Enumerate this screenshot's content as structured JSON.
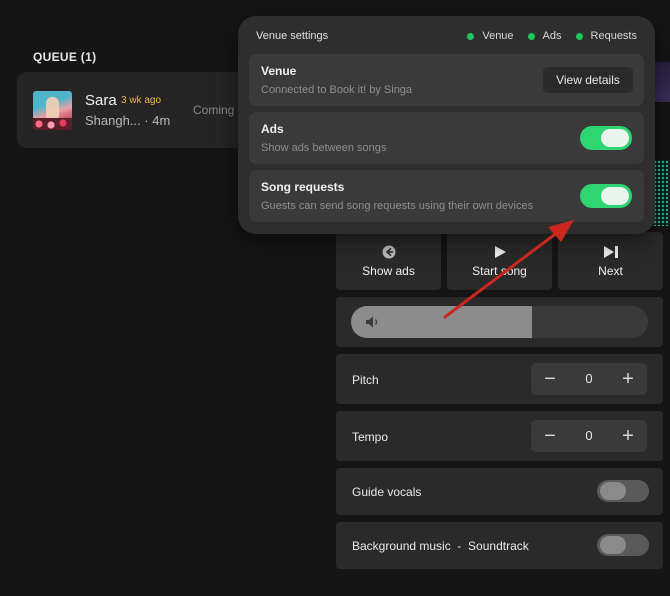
{
  "queue": {
    "title": "QUEUE (1)",
    "item": {
      "name": "Sara",
      "time_ago": "3 wk ago",
      "song": "Shangh... · 4m",
      "status": "Coming"
    }
  },
  "controls": {
    "show_ads_label": "Show ads",
    "start_song_label": "Start song",
    "next_label": "Next",
    "icons": {
      "show_ads": "arrow-left-circle-icon",
      "start_song": "play-icon",
      "next": "skip-next-icon"
    }
  },
  "volume": {
    "level_fraction": 0.61,
    "icon": "speaker-icon"
  },
  "pitch": {
    "label": "Pitch",
    "value": "0"
  },
  "tempo": {
    "label": "Tempo",
    "value": "0"
  },
  "guide_vocals": {
    "label": "Guide vocals",
    "enabled": false
  },
  "background_music": {
    "label": "Background music  -  Soundtrack",
    "enabled": false
  },
  "venue_settings": {
    "title": "Venue settings",
    "indicators": [
      "Venue",
      "Ads",
      "Requests"
    ],
    "venue": {
      "title": "Venue",
      "description": "Connected to Book it! by Singa",
      "button_label": "View details"
    },
    "ads": {
      "title": "Ads",
      "description": "Show ads between songs",
      "enabled": true
    },
    "song_requests": {
      "title": "Song requests",
      "description": "Guests can send song requests using their own devices",
      "enabled": true
    }
  },
  "colors": {
    "accent_green": "#2fd571",
    "indicator_green": "#22c55e",
    "time_ago_orange": "#f2b43c",
    "annotation_red": "#c8281e"
  }
}
